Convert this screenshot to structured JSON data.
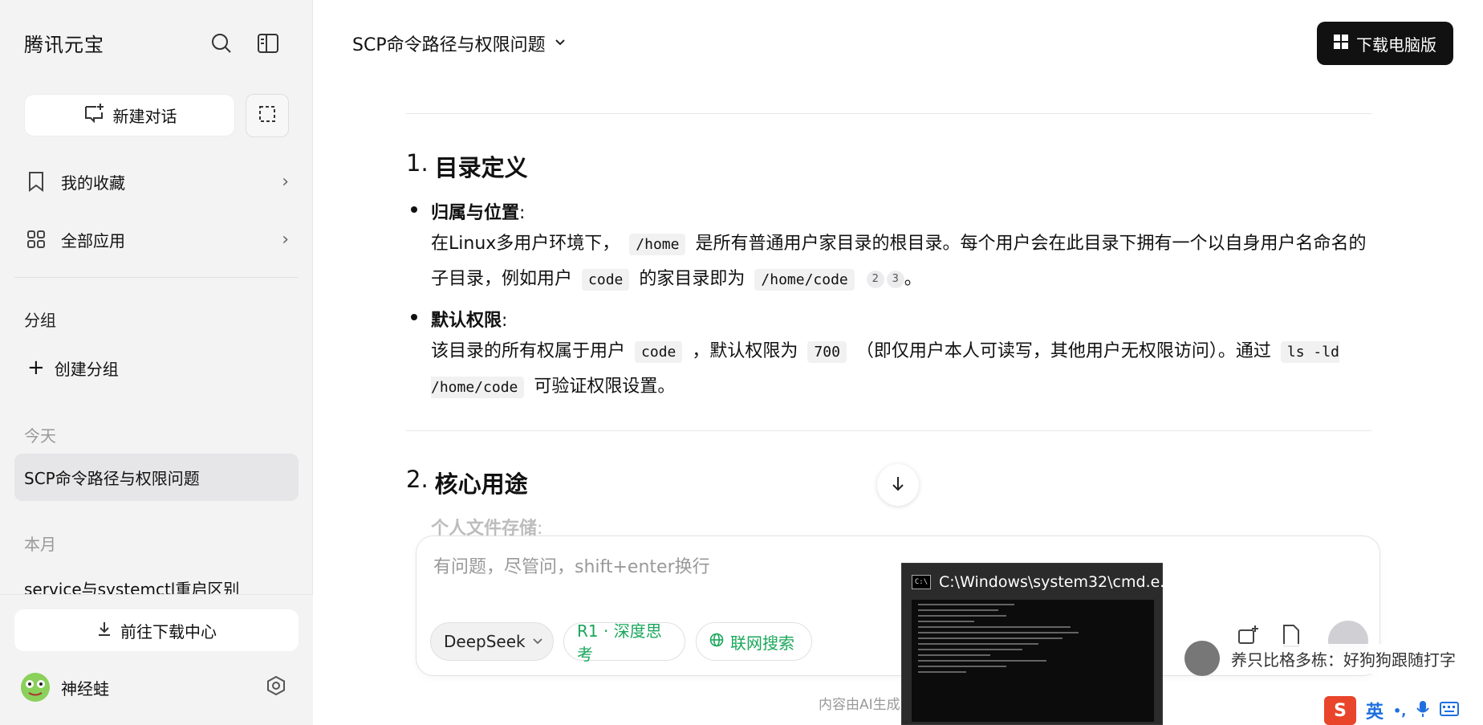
{
  "sidebar": {
    "brand": "腾讯元宝",
    "new_chat_label": "新建对话",
    "favorites_label": "我的收藏",
    "all_apps_label": "全部应用",
    "group_section": "分组",
    "create_group_label": "创建分组",
    "today_label": "今天",
    "active_chat": "SCP命令路径与权限问题",
    "month_label": "本月",
    "month_chat": "service与systemctl重启区别",
    "download_center_label": "前往下载中心",
    "username": "神经蛙"
  },
  "header": {
    "title": "SCP命令路径与权限问题",
    "download_pc_label": "下载电脑版"
  },
  "content": {
    "section1_num": "1.",
    "section1_title": "目录定义",
    "b1_head": "归属与位置",
    "colon": ":",
    "b1_p1a": "在Linux多用户环境下，",
    "b1_code1": "/home",
    "b1_p1b": "是所有普通用户家目录的根目录。每个用户会在此目录下拥有一个以自身用户名命名的子目录，例如用户",
    "b1_code2": "code",
    "b1_p1c": "的家目录即为",
    "b1_code3": "/home/code",
    "cite_2": "2",
    "cite_3": "3",
    "period": "。",
    "b2_head": "默认权限",
    "b2_pa": "该目录的所有权属于用户",
    "b2_code1": "code",
    "b2_pb": "，默认权限为",
    "b2_code2": "700",
    "b2_pc": "（即仅用户本人可读写，其他用户无权限访问）。通过",
    "b2_code3": "ls -ld /home/code",
    "b2_pd": "可验证权限设置。",
    "section2_num": "2.",
    "section2_title": "核心用途",
    "faded_item": "个人文件存储"
  },
  "composer": {
    "placeholder": "有问题，尽管问，shift+enter换行",
    "model_label": "DeepSeek",
    "think_label": "R1 · 深度思考",
    "search_label": "联网搜索"
  },
  "footer_note": "内容由AI生成",
  "cmd_window": {
    "title": "C:\\Windows\\system32\\cmd.e..."
  },
  "danmaku_text": "养只比格多栋：好狗狗跟随打字",
  "ime": {
    "logo": "S",
    "mode": "英"
  },
  "colors": {
    "accent_green": "#1aa75b",
    "dark_button": "#111111"
  }
}
